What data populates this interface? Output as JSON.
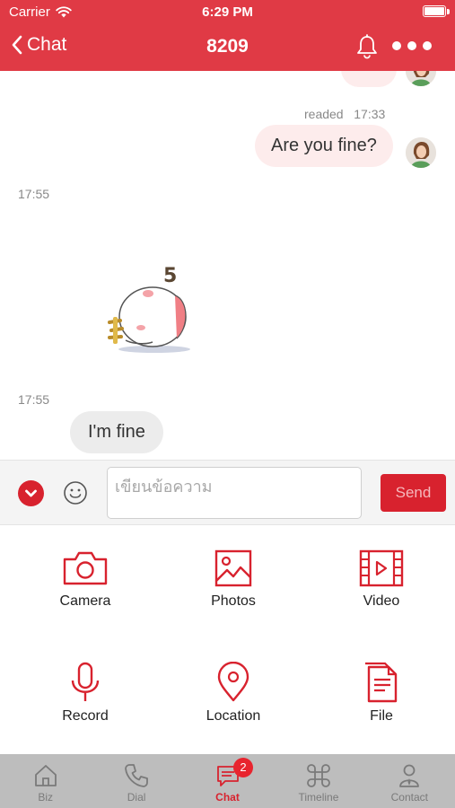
{
  "status_bar": {
    "carrier": "Carrier",
    "time": "6:29 PM"
  },
  "nav": {
    "back_label": "Chat",
    "title": "8209"
  },
  "messages": {
    "outgoing": {
      "read_status": "readed",
      "time": "17:33",
      "text": "Are you fine?"
    },
    "sticker_time": "17:55",
    "incoming": {
      "time": "17:55",
      "text": "I'm fine"
    }
  },
  "composer": {
    "placeholder": "เขียนข้อความ",
    "value": "",
    "send_label": "Send"
  },
  "attachments": [
    {
      "label": "Camera",
      "icon": "camera-icon"
    },
    {
      "label": "Photos",
      "icon": "photo-icon"
    },
    {
      "label": "Video",
      "icon": "video-icon"
    },
    {
      "label": "Record",
      "icon": "microphone-icon"
    },
    {
      "label": "Location",
      "icon": "location-pin-icon"
    },
    {
      "label": "File",
      "icon": "file-icon"
    }
  ],
  "tabs": [
    {
      "label": "Biz",
      "icon": "home-icon"
    },
    {
      "label": "Dial",
      "icon": "phone-icon"
    },
    {
      "label": "Chat",
      "icon": "chat-icon",
      "badge": "2"
    },
    {
      "label": "Timeline",
      "icon": "command-icon"
    },
    {
      "label": "Contact",
      "icon": "contact-icon"
    }
  ],
  "colors": {
    "brand": "#e03a45",
    "accent": "#d8222e",
    "tab_bar": "#bdbdbd",
    "outgoing_bubble": "#fdecec",
    "incoming_bubble": "#ececec"
  }
}
